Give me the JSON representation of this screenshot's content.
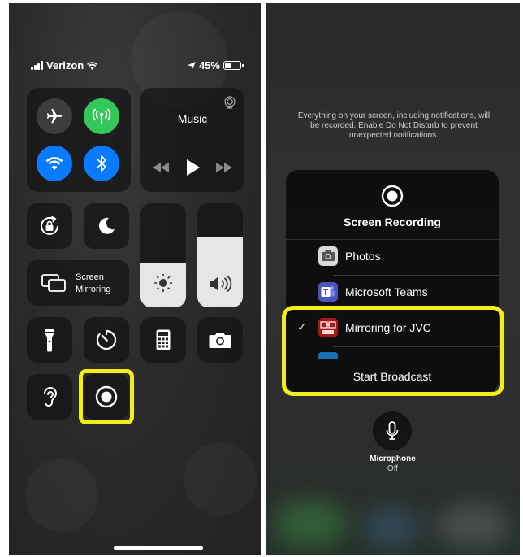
{
  "left": {
    "status": {
      "carrier": "Verizon",
      "battery_text": "45%",
      "battery_level": 0.45
    },
    "music": {
      "title": "Music"
    },
    "screen_mirroring": {
      "line1": "Screen",
      "line2": "Mirroring"
    },
    "brightness_level": 0.42,
    "volume_level": 0.68,
    "colors": {
      "cellular_green": "#34c759",
      "toggle_blue": "#0a7aff",
      "highlight_yellow": "#f2ee19"
    },
    "icons": [
      "airplane-icon",
      "cellular-data-icon",
      "wifi-icon",
      "bluetooth-icon",
      "airplay-icon",
      "rewind-icon",
      "play-icon",
      "fast-forward-icon",
      "orientation-lock-icon",
      "moon-icon",
      "screen-mirroring-icon",
      "brightness-icon",
      "volume-icon",
      "flashlight-icon",
      "timer-icon",
      "calculator-icon",
      "camera-icon",
      "hearing-icon",
      "screen-record-icon"
    ]
  },
  "right": {
    "notice": "Everything on your screen, including notifications, will be recorded. Enable Do Not Disturb to prevent unexpected notifications.",
    "popup": {
      "title": "Screen Recording",
      "apps": [
        {
          "label": "Photos",
          "icon": "photos-camera-icon",
          "selected": false
        },
        {
          "label": "Microsoft Teams",
          "icon": "teams-icon",
          "selected": false
        },
        {
          "label": "Mirroring for JVC",
          "icon": "jvc-mirroring-icon",
          "selected": true
        }
      ],
      "check_mark": "✓",
      "start_button": "Start Broadcast"
    },
    "microphone": {
      "label": "Microphone",
      "state": "Off"
    }
  }
}
